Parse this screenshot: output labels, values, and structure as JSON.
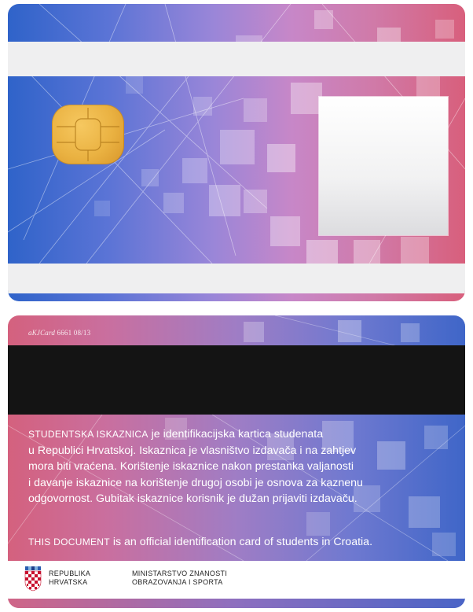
{
  "back": {
    "serial_prefix": "aKJCard",
    "serial_number": " 6661 08/13",
    "text": {
      "line1_caps": "STUDENTSKA ISKAZNICA",
      "line1_rest": " je identifikacijska kartica studenata",
      "line2": "u Republici Hrvatskoj. Iskaznica je vlasništvo izdavača i na zahtjev",
      "line3": "mora biti vraćena. Korištenje iskaznice nakon prestanka valjanosti",
      "line4": "i davanje iskaznice na korištenje drugoj osobi je osnova za kaznenu",
      "line5": "odgovornost. Gubitak iskaznice korisnik je dužan prijaviti izdavaču."
    },
    "english": {
      "caps": "THIS DOCUMENT",
      "rest": " is an official identification card of students in Croatia."
    },
    "footer": {
      "republika_line1": "REPUBLIKA",
      "republika_line2": "HRVATSKA",
      "ministry_line1": "MINISTARSTVO ZNANOSTI",
      "ministry_line2": "OBRAZOVANJA I SPORTA"
    }
  },
  "colors": {
    "front_left": "#2f63c9",
    "front_right": "#d85f7c",
    "back_left": "#d4617e",
    "back_right": "#3f66c8",
    "chip": "#eab242",
    "magnetic_stripe": "#141414"
  }
}
